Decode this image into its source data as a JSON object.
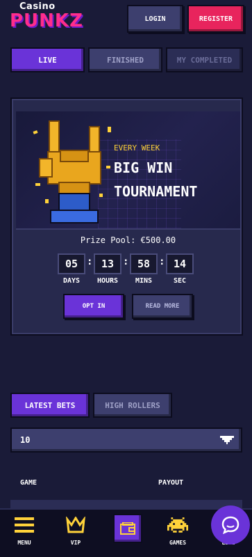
{
  "header": {
    "logo_top": "Casino",
    "logo_main": "PUNKZ",
    "login_label": "LOGIN",
    "register_label": "REGISTER"
  },
  "tabs": [
    {
      "label": "LIVE",
      "active": true
    },
    {
      "label": "FINISHED",
      "active": false
    },
    {
      "label": "MY COMPLETED",
      "active": false
    }
  ],
  "tournament": {
    "eyebrow": "EVERY WEEK",
    "title_line1": "BIG WIN",
    "title_line2": "TOURNAMENT",
    "prize_pool": "Prize Pool: €500.00",
    "countdown": {
      "days": "05",
      "hours": "13",
      "mins": "58",
      "sec": "14",
      "days_label": "DAYS",
      "hours_label": "HOURS",
      "mins_label": "MINS",
      "sec_label": "SEC"
    },
    "opt_in_label": "OPT IN",
    "read_more_label": "READ MORE"
  },
  "bets": {
    "tabs": [
      {
        "label": "LATEST BETS",
        "active": true
      },
      {
        "label": "HIGH ROLLERS",
        "active": false
      }
    ],
    "count_select": "10",
    "columns": {
      "game": "GAME",
      "payout": "PAYOUT"
    }
  },
  "bottom_nav": [
    {
      "label": "MENU",
      "icon": "hamburger-icon"
    },
    {
      "label": "VIP",
      "icon": "crown-icon"
    },
    {
      "label": "",
      "icon": "wallet-icon"
    },
    {
      "label": "GAMES",
      "icon": "space-invader-icon"
    },
    {
      "label": "LIVE",
      "icon": "chat-icon"
    }
  ],
  "colors": {
    "background": "#1a1b38",
    "accent_purple": "#6a33d8",
    "register_pink": "#e8245d",
    "logo_pink": "#ff2d8c",
    "gold": "#ffd23a"
  }
}
